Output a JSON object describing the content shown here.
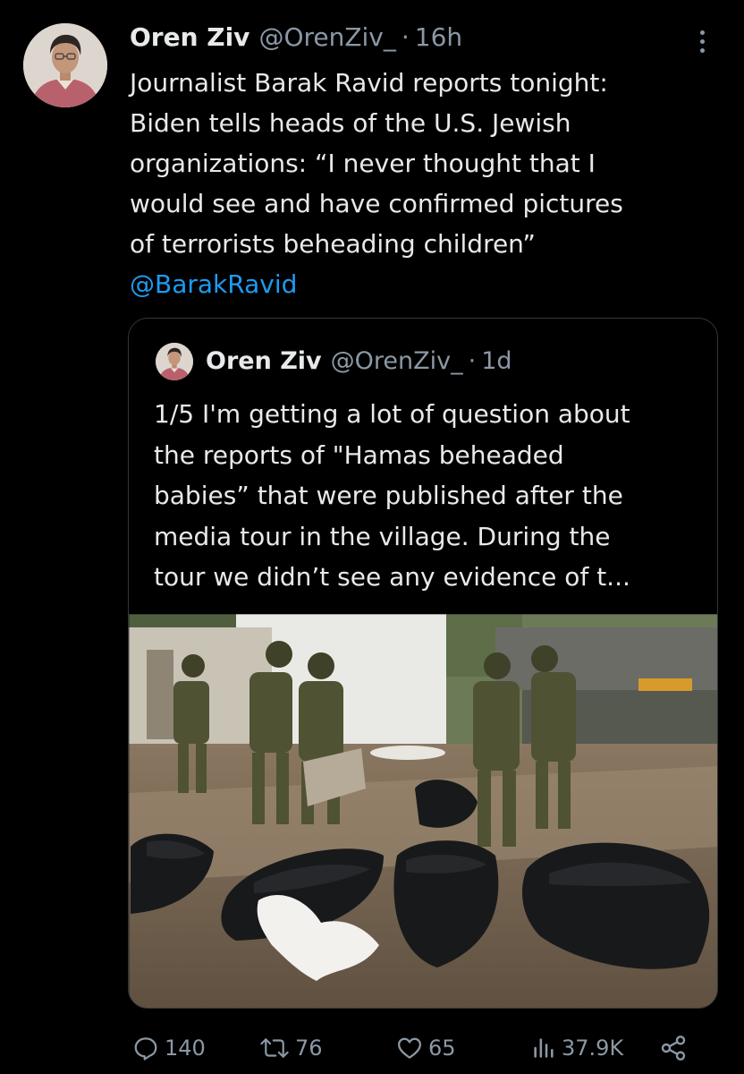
{
  "tweet": {
    "author_name": "Oren Ziv",
    "author_handle": "@OrenZiv_",
    "separator": "·",
    "time": "16h",
    "lines": [
      "Journalist Barak Ravid reports tonight:",
      "Biden tells heads of the U.S. Jewish",
      "organizations: “I never thought that I",
      "would see and have confirmed pictures",
      "of terrorists beheading children”"
    ],
    "mention": "@BarakRavid"
  },
  "quoted": {
    "author_name": "Oren Ziv",
    "author_handle": "@OrenZiv_",
    "separator": "·",
    "time": "1d",
    "lines": [
      "1/5 I'm getting a lot of question about",
      "the reports of \"Hamas beheaded",
      "babies” that were published after the",
      "media tour in the village. During the",
      "tour we didn’t see any evidence of t..."
    ],
    "image_icon": "photo"
  },
  "actions": {
    "replies": "140",
    "reposts": "76",
    "likes": "65",
    "views": "37.9K",
    "icons": [
      "reply-icon",
      "repost-icon",
      "like-icon",
      "views-icon",
      "share-icon"
    ]
  },
  "colors": {
    "background": "#000000",
    "text": "#e7e9ea",
    "muted": "#8b98a5",
    "link": "#1d9bf0",
    "border": "#333639"
  }
}
